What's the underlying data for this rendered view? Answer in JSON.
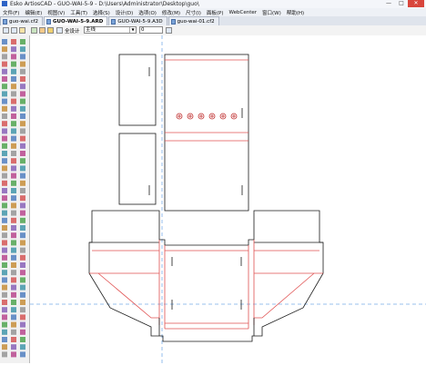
{
  "window": {
    "title": "Esko ArtiosCAD - GUO-WAI-5-9 - D:\\Users\\Administrator\\Desktop\\guo\\",
    "buttons": [
      "—",
      "□",
      "✕"
    ]
  },
  "menu": [
    "文件(F)",
    "编辑(E)",
    "视图(V)",
    "工具(T)",
    "选择(S)",
    "设计(D)",
    "选项(O)",
    "修改(M)",
    "尺寸(I)",
    "面板(P)",
    "WebCenter",
    "窗口(W)",
    "帮助(H)"
  ],
  "tabs": [
    {
      "label": "guo-wai.cf2",
      "active": false
    },
    {
      "label": "GUO-WAI-5-9.ARD",
      "active": true
    },
    {
      "label": "GUO-WAI-5-9.A3D",
      "active": false
    },
    {
      "label": "guo-wai-01.cf2",
      "active": false
    }
  ],
  "toolbar": {
    "view_label": "全设计",
    "layer_select": "主线",
    "number_value": "0"
  },
  "colors": {
    "cut_line": "#1a1a1a",
    "crease_line": "#e05050",
    "guide_line": "#7aaee8",
    "accent": "#2c62c6"
  },
  "icons": {
    "close": "close-icon",
    "minimize": "minimize-icon",
    "maximize": "maximize-icon"
  }
}
